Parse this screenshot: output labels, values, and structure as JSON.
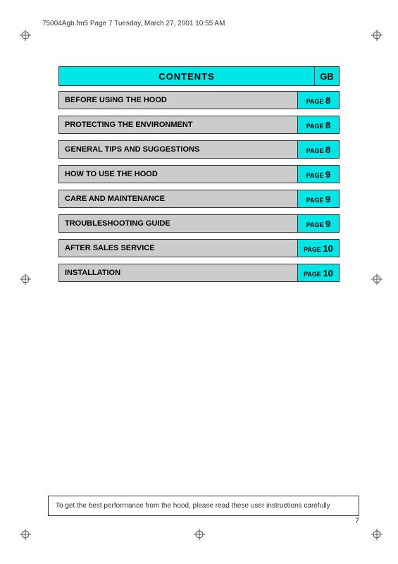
{
  "header": {
    "file_info": "75004Agb.fm5  Page 7  Tuesday, March 27, 2001  10:55 AM"
  },
  "contents": {
    "title": "CONTENTS",
    "gb_label": "GB",
    "rows": [
      {
        "label": "BEFORE USING THE HOOD",
        "page_label": "PAGE",
        "page_num": "8"
      },
      {
        "label": "PROTECTING THE ENVIRONMENT",
        "page_label": "PAGE",
        "page_num": "8"
      },
      {
        "label": "GENERAL TIPS AND SUGGESTIONS",
        "page_label": "PAGE",
        "page_num": "8"
      },
      {
        "label": "HOW TO USE THE HOOD",
        "page_label": "PAGE",
        "page_num": "9"
      },
      {
        "label": "CARE AND MAINTENANCE",
        "page_label": "PAGE",
        "page_num": "9"
      },
      {
        "label": "TROUBLESHOOTING GUIDE",
        "page_label": "PAGE",
        "page_num": "9"
      },
      {
        "label": "AFTER SALES SERVICE",
        "page_label": "PAGE",
        "page_num": "10"
      },
      {
        "label": "INSTALLATION",
        "page_label": "PAGE",
        "page_num": "10"
      }
    ]
  },
  "bottom_note": {
    "text": "To get the best performance from the hood, please read these user instructions carefully"
  },
  "page_number": "7"
}
